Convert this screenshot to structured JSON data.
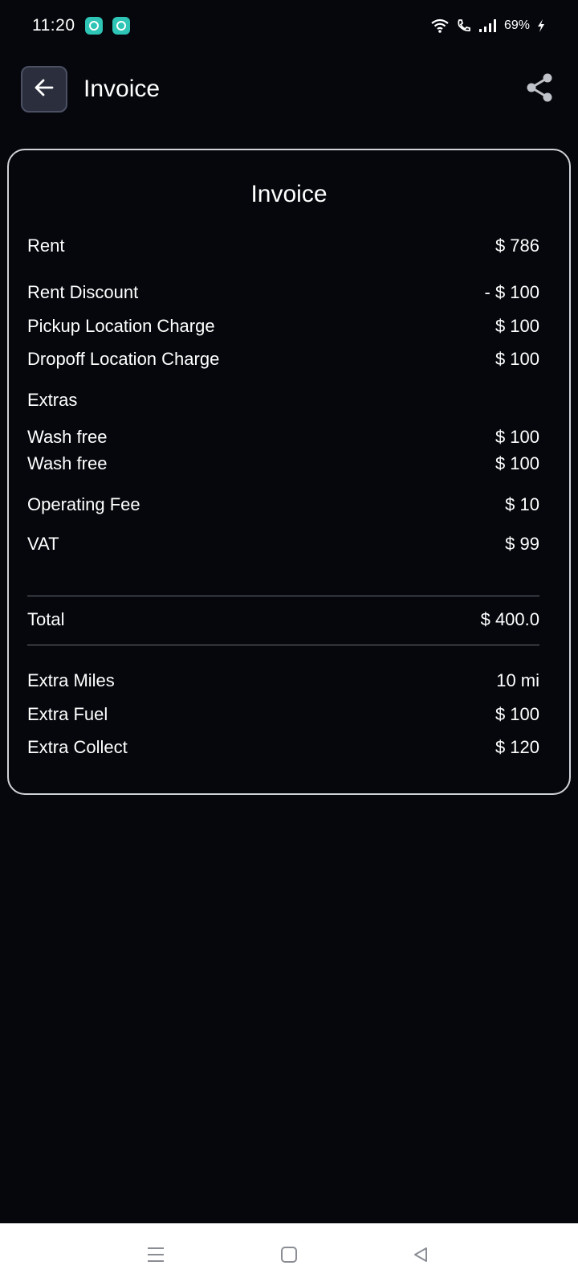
{
  "status_bar": {
    "time": "11:20",
    "battery": "69%",
    "icons": [
      "app-notification-icon",
      "app-notification-icon",
      "wifi-icon",
      "wifi-call-icon",
      "signal-icon",
      "charging-icon"
    ]
  },
  "app_bar": {
    "title": "Invoice",
    "back_icon": "arrow-left-icon",
    "share_icon": "share-icon"
  },
  "invoice": {
    "title": "Invoice",
    "rent": {
      "label": "Rent",
      "value": "$ 786"
    },
    "rent_discount": {
      "label": "Rent Discount",
      "value": "- $ 100"
    },
    "pickup_charge": {
      "label": "Pickup Location Charge",
      "value": "$ 100"
    },
    "dropoff_charge": {
      "label": "Dropoff Location Charge",
      "value": "$ 100"
    },
    "extras_heading": "Extras",
    "extras": [
      {
        "label": "Wash free",
        "value": "$ 100"
      },
      {
        "label": "Wash free",
        "value": "$ 100"
      }
    ],
    "operating_fee": {
      "label": "Operating Fee",
      "value": "$ 10"
    },
    "vat": {
      "label": "VAT",
      "value": "$ 99"
    },
    "total": {
      "label": "Total",
      "value": "$ 400.0"
    },
    "extra_miles": {
      "label": "Extra Miles",
      "value": "10 mi"
    },
    "extra_fuel": {
      "label": "Extra Fuel",
      "value": "$ 100"
    },
    "extra_collect": {
      "label": "Extra Collect",
      "value": "$ 120"
    }
  },
  "nav_bar": {
    "icons": [
      "menu-icon",
      "home-icon",
      "back-triangle-icon"
    ]
  },
  "colors": {
    "background": "#05070c",
    "card_border": "#cfd2d8",
    "back_button_bg": "#2b2f3d",
    "badge": "#2ec4b6",
    "nav_bar": "#ffffff"
  }
}
